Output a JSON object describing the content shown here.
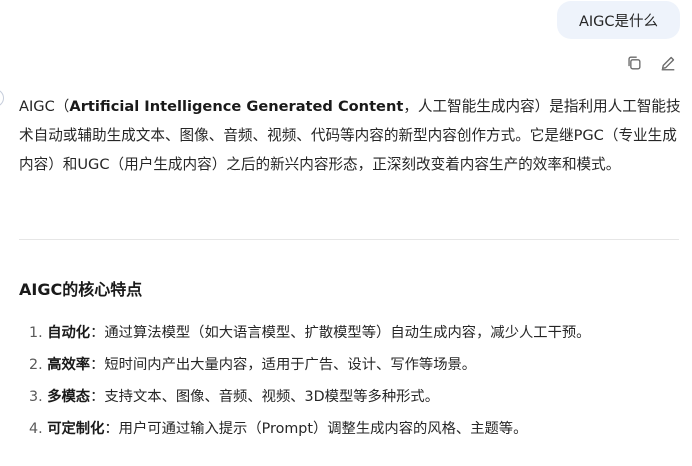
{
  "user_message": {
    "text": "AIGC是什么"
  },
  "message_actions": {
    "copy_icon": "copy-icon",
    "edit_icon": "edit-icon"
  },
  "answer": {
    "intro": {
      "term": "AIGC",
      "paren_open": "（",
      "full_name": "Artificial Intelligence Generated Content",
      "rest": "，人工智能生成内容）是指利用人工智能技术自动或辅助生成文本、图像、音频、视频、代码等内容的新型内容创作方式。它是继PGC（专业生成内容）和UGC（用户生成内容）之后的新兴内容形态，正深刻改变着内容生产的效率和模式。"
    },
    "section_title": "AIGC的核心特点",
    "features": [
      {
        "num": "1.",
        "term": "自动化",
        "desc": "：通过算法模型（如大语言模型、扩散模型等）自动生成内容，减少人工干预。"
      },
      {
        "num": "2.",
        "term": "高效率",
        "desc": "：短时间内产出大量内容，适用于广告、设计、写作等场景。"
      },
      {
        "num": "3.",
        "term": "多模态",
        "desc": "：支持文本、图像、音频、视频、3D模型等多种形式。"
      },
      {
        "num": "4.",
        "term": "可定制化",
        "desc": "：用户可通过输入提示（Prompt）调整生成内容的风格、主题等。"
      }
    ]
  }
}
